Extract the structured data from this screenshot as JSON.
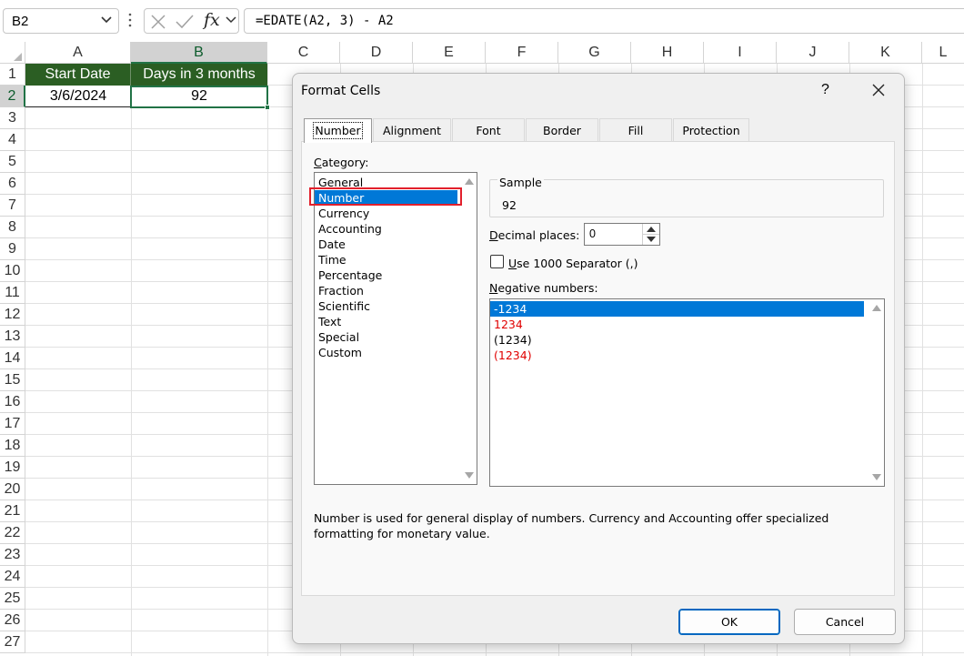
{
  "formula_bar": {
    "name_box": "B2",
    "fx": "fx",
    "formula": "=EDATE(A2, 3) - A2"
  },
  "sheet": {
    "columns": [
      "A",
      "B",
      "C",
      "D",
      "E",
      "F",
      "G",
      "H",
      "I",
      "J",
      "K",
      "L"
    ],
    "rows": [
      "1",
      "2",
      "3",
      "4",
      "5",
      "6",
      "7",
      "8",
      "9",
      "10",
      "11",
      "12",
      "13",
      "14",
      "15",
      "16",
      "17",
      "18",
      "19",
      "20",
      "21",
      "22",
      "23",
      "24",
      "25",
      "26",
      "27"
    ],
    "selected_cell": "B2",
    "header_fill": "#2b5e23",
    "cells": {
      "A1": "Start Date",
      "B1": "Days in 3 months",
      "A2": "3/6/2024",
      "B2": "92"
    }
  },
  "dialog": {
    "title": "Format Cells",
    "help": "?",
    "tabs": [
      "Number",
      "Alignment",
      "Font",
      "Border",
      "Fill",
      "Protection"
    ],
    "active_tab": "Number",
    "category_label": "Category:",
    "categories": [
      "General",
      "Number",
      "Currency",
      "Accounting",
      "Date",
      "Time",
      "Percentage",
      "Fraction",
      "Scientific",
      "Text",
      "Special",
      "Custom"
    ],
    "selected_category": "Number",
    "sample_label": "Sample",
    "sample_value": "92",
    "decimal_label": "Decimal places:",
    "decimal_value": "0",
    "separator_label": "Use 1000 Separator (,)",
    "separator_checked": false,
    "negative_label": "Negative numbers:",
    "negative_options": [
      {
        "text": "-1234",
        "color": "#000000"
      },
      {
        "text": "1234",
        "color": "#e00000"
      },
      {
        "text": "(1234)",
        "color": "#000000"
      },
      {
        "text": "(1234)",
        "color": "#e00000"
      }
    ],
    "selected_negative": "-1234",
    "description": "Number is used for general display of numbers.  Currency and Accounting offer specialized formatting for monetary value.",
    "ok_label": "OK",
    "cancel_label": "Cancel",
    "selection_color": "#0078d7",
    "highlight_color": "#e2202c"
  }
}
